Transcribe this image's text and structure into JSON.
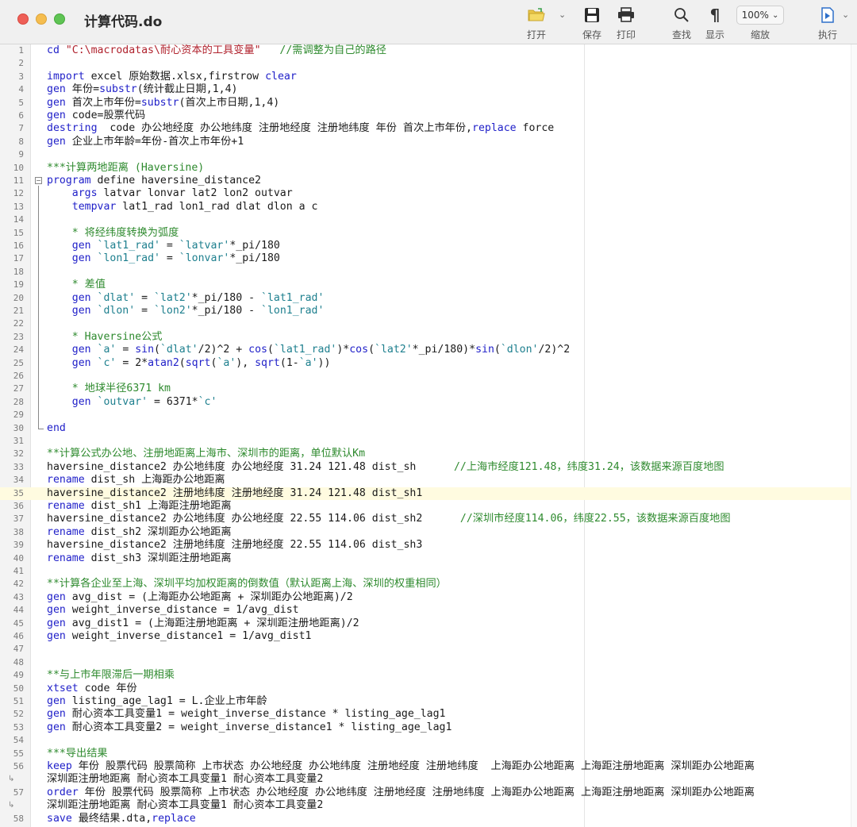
{
  "window": {
    "title": "计算代码.do"
  },
  "toolbar": {
    "open_label": "打开",
    "save_label": "保存",
    "print_label": "打印",
    "find_label": "查找",
    "show_label": "显示",
    "zoom_label": "缩放",
    "zoom_value": "100%",
    "run_label": "执行"
  },
  "colors": {
    "keyword": "#2121c9",
    "comment": "#2e8a2e",
    "string": "#b0222d",
    "macro": "#1d7f8e",
    "current_line": "#fffbe0"
  },
  "editor": {
    "current_line": 35,
    "folded_block": {
      "start": 11,
      "end": 30
    },
    "wrap_markers": [
      55,
      56
    ],
    "lines": [
      {
        "n": "1",
        "t": [
          [
            "k",
            "cd "
          ],
          [
            "s",
            "\"C:\\macrodatas\\耐心资本的工具变量\""
          ],
          [
            "p",
            "   "
          ],
          [
            "c",
            "//需调整为自己的路径"
          ]
        ]
      },
      {
        "n": "2",
        "t": []
      },
      {
        "n": "3",
        "t": [
          [
            "k",
            "import"
          ],
          [
            "p",
            " excel 原始数据.xlsx,firstrow "
          ],
          [
            "k",
            "clear"
          ]
        ]
      },
      {
        "n": "4",
        "t": [
          [
            "k",
            "gen"
          ],
          [
            "p",
            " 年份="
          ],
          [
            "k",
            "substr"
          ],
          [
            "p",
            "(统计截止日期,1,4)"
          ]
        ]
      },
      {
        "n": "5",
        "t": [
          [
            "k",
            "gen"
          ],
          [
            "p",
            " 首次上市年份="
          ],
          [
            "k",
            "substr"
          ],
          [
            "p",
            "(首次上市日期,1,4)"
          ]
        ]
      },
      {
        "n": "6",
        "t": [
          [
            "k",
            "gen"
          ],
          [
            "p",
            " code=股票代码"
          ]
        ]
      },
      {
        "n": "7",
        "t": [
          [
            "k",
            "destring"
          ],
          [
            "p",
            "  code 办公地经度 办公地纬度 注册地经度 注册地纬度 年份 首次上市年份,"
          ],
          [
            "k",
            "replace"
          ],
          [
            "p",
            " force"
          ]
        ]
      },
      {
        "n": "8",
        "t": [
          [
            "k",
            "gen"
          ],
          [
            "p",
            " 企业上市年龄=年份-首次上市年份+1"
          ]
        ]
      },
      {
        "n": "9",
        "t": []
      },
      {
        "n": "10",
        "t": [
          [
            "c",
            "***计算两地距离 (Haversine)"
          ]
        ]
      },
      {
        "n": "11",
        "t": [
          [
            "k",
            "program"
          ],
          [
            "p",
            " define haversine_distance2"
          ]
        ]
      },
      {
        "n": "12",
        "t": [
          [
            "p",
            "    "
          ],
          [
            "k",
            "args"
          ],
          [
            "p",
            " latvar lonvar lat2 lon2 outvar"
          ]
        ]
      },
      {
        "n": "13",
        "t": [
          [
            "p",
            "    "
          ],
          [
            "k",
            "tempvar"
          ],
          [
            "p",
            " lat1_rad lon1_rad dlat dlon a c"
          ]
        ]
      },
      {
        "n": "14",
        "t": []
      },
      {
        "n": "15",
        "t": [
          [
            "p",
            "    "
          ],
          [
            "c",
            "* 将经纬度转换为弧度"
          ]
        ]
      },
      {
        "n": "16",
        "t": [
          [
            "p",
            "    "
          ],
          [
            "k",
            "gen"
          ],
          [
            "p",
            " "
          ],
          [
            "m",
            "`lat1_rad'"
          ],
          [
            "p",
            " = "
          ],
          [
            "m",
            "`latvar'"
          ],
          [
            "p",
            "*_pi/180"
          ]
        ]
      },
      {
        "n": "17",
        "t": [
          [
            "p",
            "    "
          ],
          [
            "k",
            "gen"
          ],
          [
            "p",
            " "
          ],
          [
            "m",
            "`lon1_rad'"
          ],
          [
            "p",
            " = "
          ],
          [
            "m",
            "`lonvar'"
          ],
          [
            "p",
            "*_pi/180"
          ]
        ]
      },
      {
        "n": "18",
        "t": []
      },
      {
        "n": "19",
        "t": [
          [
            "p",
            "    "
          ],
          [
            "c",
            "* 差值"
          ]
        ]
      },
      {
        "n": "20",
        "t": [
          [
            "p",
            "    "
          ],
          [
            "k",
            "gen"
          ],
          [
            "p",
            " "
          ],
          [
            "m",
            "`dlat'"
          ],
          [
            "p",
            " = "
          ],
          [
            "m",
            "`lat2'"
          ],
          [
            "p",
            "*_pi/180 - "
          ],
          [
            "m",
            "`lat1_rad'"
          ]
        ]
      },
      {
        "n": "21",
        "t": [
          [
            "p",
            "    "
          ],
          [
            "k",
            "gen"
          ],
          [
            "p",
            " "
          ],
          [
            "m",
            "`dlon'"
          ],
          [
            "p",
            " = "
          ],
          [
            "m",
            "`lon2'"
          ],
          [
            "p",
            "*_pi/180 - "
          ],
          [
            "m",
            "`lon1_rad'"
          ]
        ]
      },
      {
        "n": "22",
        "t": []
      },
      {
        "n": "23",
        "t": [
          [
            "p",
            "    "
          ],
          [
            "c",
            "* Haversine公式"
          ]
        ]
      },
      {
        "n": "24",
        "t": [
          [
            "p",
            "    "
          ],
          [
            "k",
            "gen"
          ],
          [
            "p",
            " "
          ],
          [
            "m",
            "`a'"
          ],
          [
            "p",
            " = "
          ],
          [
            "k",
            "sin"
          ],
          [
            "p",
            "("
          ],
          [
            "m",
            "`dlat'"
          ],
          [
            "p",
            "/2)^2 + "
          ],
          [
            "k",
            "cos"
          ],
          [
            "p",
            "("
          ],
          [
            "m",
            "`lat1_rad'"
          ],
          [
            "p",
            ")*"
          ],
          [
            "k",
            "cos"
          ],
          [
            "p",
            "("
          ],
          [
            "m",
            "`lat2'"
          ],
          [
            "p",
            "*_pi/180)*"
          ],
          [
            "k",
            "sin"
          ],
          [
            "p",
            "("
          ],
          [
            "m",
            "`dlon'"
          ],
          [
            "p",
            "/2)^2"
          ]
        ]
      },
      {
        "n": "25",
        "t": [
          [
            "p",
            "    "
          ],
          [
            "k",
            "gen"
          ],
          [
            "p",
            " "
          ],
          [
            "m",
            "`c'"
          ],
          [
            "p",
            " = 2*"
          ],
          [
            "k",
            "atan2"
          ],
          [
            "p",
            "("
          ],
          [
            "k",
            "sqrt"
          ],
          [
            "p",
            "("
          ],
          [
            "m",
            "`a'"
          ],
          [
            "p",
            "), "
          ],
          [
            "k",
            "sqrt"
          ],
          [
            "p",
            "(1-"
          ],
          [
            "m",
            "`a'"
          ],
          [
            "p",
            "))"
          ]
        ]
      },
      {
        "n": "26",
        "t": []
      },
      {
        "n": "27",
        "t": [
          [
            "p",
            "    "
          ],
          [
            "c",
            "* 地球半径6371 km"
          ]
        ]
      },
      {
        "n": "28",
        "t": [
          [
            "p",
            "    "
          ],
          [
            "k",
            "gen"
          ],
          [
            "p",
            " "
          ],
          [
            "m",
            "`outvar'"
          ],
          [
            "p",
            " = 6371*"
          ],
          [
            "m",
            "`c'"
          ]
        ]
      },
      {
        "n": "29",
        "t": []
      },
      {
        "n": "30",
        "t": [
          [
            "k",
            "end"
          ]
        ]
      },
      {
        "n": "31",
        "t": []
      },
      {
        "n": "32",
        "t": [
          [
            "c",
            "**计算公式办公地、注册地距离上海市、深圳市的距离，单位默认Km"
          ]
        ]
      },
      {
        "n": "33",
        "t": [
          [
            "p",
            "haversine_distance2 办公地纬度 办公地经度 31.24 121.48 dist_sh      "
          ],
          [
            "c",
            "//上海市经度121.48，纬度31.24，该数据来源百度地图"
          ]
        ]
      },
      {
        "n": "34",
        "t": [
          [
            "k",
            "rename"
          ],
          [
            "p",
            " dist_sh 上海距办公地距离"
          ]
        ]
      },
      {
        "n": "35",
        "t": [
          [
            "p",
            "haversine_distance2 注册地纬度 注册地经度 31.24 121.48 dist_sh1"
          ]
        ]
      },
      {
        "n": "36",
        "t": [
          [
            "k",
            "rename"
          ],
          [
            "p",
            " dist_sh1 上海距注册地距离"
          ]
        ]
      },
      {
        "n": "37",
        "t": [
          [
            "p",
            "haversine_distance2 办公地纬度 办公地经度 22.55 114.06 dist_sh2      "
          ],
          [
            "c",
            "//深圳市经度114.06，纬度22.55，该数据来源百度地图"
          ]
        ]
      },
      {
        "n": "38",
        "t": [
          [
            "k",
            "rename"
          ],
          [
            "p",
            " dist_sh2 深圳距办公地距离"
          ]
        ]
      },
      {
        "n": "39",
        "t": [
          [
            "p",
            "haversine_distance2 注册地纬度 注册地经度 22.55 114.06 dist_sh3"
          ]
        ]
      },
      {
        "n": "40",
        "t": [
          [
            "k",
            "rename"
          ],
          [
            "p",
            " dist_sh3 深圳距注册地距离"
          ]
        ]
      },
      {
        "n": "41",
        "t": []
      },
      {
        "n": "42",
        "t": [
          [
            "c",
            "**计算各企业至上海、深圳平均加权距离的倒数值（默认距离上海、深圳的权重相同）"
          ]
        ]
      },
      {
        "n": "43",
        "t": [
          [
            "k",
            "gen"
          ],
          [
            "p",
            " avg_dist = (上海距办公地距离 + 深圳距办公地距离)/2"
          ]
        ]
      },
      {
        "n": "44",
        "t": [
          [
            "k",
            "gen"
          ],
          [
            "p",
            " weight_inverse_distance = 1/avg_dist"
          ]
        ]
      },
      {
        "n": "45",
        "t": [
          [
            "k",
            "gen"
          ],
          [
            "p",
            " avg_dist1 = (上海距注册地距离 + 深圳距注册地距离)/2"
          ]
        ]
      },
      {
        "n": "46",
        "t": [
          [
            "k",
            "gen"
          ],
          [
            "p",
            " weight_inverse_distance1 = 1/avg_dist1"
          ]
        ]
      },
      {
        "n": "47",
        "t": []
      },
      {
        "n": "48",
        "t": []
      },
      {
        "n": "49",
        "t": [
          [
            "c",
            "**与上市年限滞后一期相乘"
          ]
        ]
      },
      {
        "n": "50",
        "t": [
          [
            "k",
            "xtset"
          ],
          [
            "p",
            " code 年份"
          ]
        ]
      },
      {
        "n": "51",
        "t": [
          [
            "k",
            "gen"
          ],
          [
            "p",
            " listing_age_lag1 = L.企业上市年龄"
          ]
        ]
      },
      {
        "n": "52",
        "t": [
          [
            "k",
            "gen"
          ],
          [
            "p",
            " 耐心资本工具变量1 = weight_inverse_distance * listing_age_lag1"
          ]
        ]
      },
      {
        "n": "53",
        "t": [
          [
            "k",
            "gen"
          ],
          [
            "p",
            " 耐心资本工具变量2 = weight_inverse_distance1 * listing_age_lag1"
          ]
        ]
      },
      {
        "n": "54",
        "t": []
      },
      {
        "n": "55",
        "t": [
          [
            "c",
            "***导出结果"
          ]
        ]
      },
      {
        "n": "56",
        "t": [
          [
            "k",
            "keep"
          ],
          [
            "p",
            " 年份 股票代码 股票简称 上市状态 办公地经度 办公地纬度 注册地经度 注册地纬度  上海距办公地距离 上海距注册地距离 深圳距办公地距离"
          ]
        ]
      },
      {
        "n": "",
        "t": [
          [
            "p",
            "深圳距注册地距离 耐心资本工具变量1 耐心资本工具变量2"
          ]
        ]
      },
      {
        "n": "57",
        "t": [
          [
            "k",
            "order"
          ],
          [
            "p",
            " 年份 股票代码 股票简称 上市状态 办公地经度 办公地纬度 注册地经度 注册地纬度 上海距办公地距离 上海距注册地距离 深圳距办公地距离"
          ]
        ]
      },
      {
        "n": "",
        "t": [
          [
            "p",
            "深圳距注册地距离 耐心资本工具变量1 耐心资本工具变量2"
          ]
        ]
      },
      {
        "n": "58",
        "t": [
          [
            "k",
            "save"
          ],
          [
            "p",
            " 最终结果.dta,"
          ],
          [
            "k",
            "replace"
          ]
        ]
      },
      {
        "n": "59",
        "t": []
      }
    ]
  }
}
